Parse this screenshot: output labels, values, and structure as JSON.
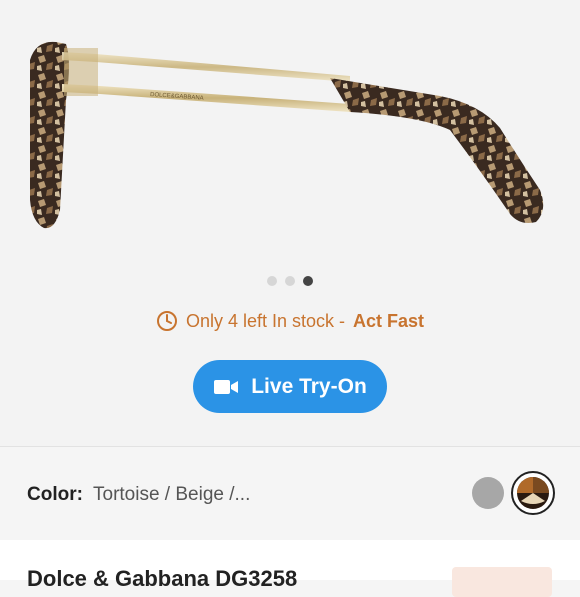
{
  "gallery": {
    "image_alt": "Dolce & Gabbana eyeglasses side view",
    "temple_engraving": "DOLCE&GABBANA",
    "slide_count": 3,
    "active_slide": 3
  },
  "stock": {
    "prefix": "Only 4 left In stock -",
    "urgent": "Act Fast"
  },
  "tryon": {
    "label": "Live Try-On"
  },
  "color": {
    "label": "Color:",
    "value": "Tortoise / Beige /...",
    "swatches": [
      {
        "name": "Grey",
        "color": "#a7a7a7",
        "selected": false
      },
      {
        "name": "Tortoise / Beige",
        "color": "#5a3a22",
        "selected": true
      }
    ]
  },
  "product": {
    "title": "Dolce & Gabbana DG3258"
  },
  "colors": {
    "accent": "#2b93e6",
    "stock": "#c8742f"
  }
}
